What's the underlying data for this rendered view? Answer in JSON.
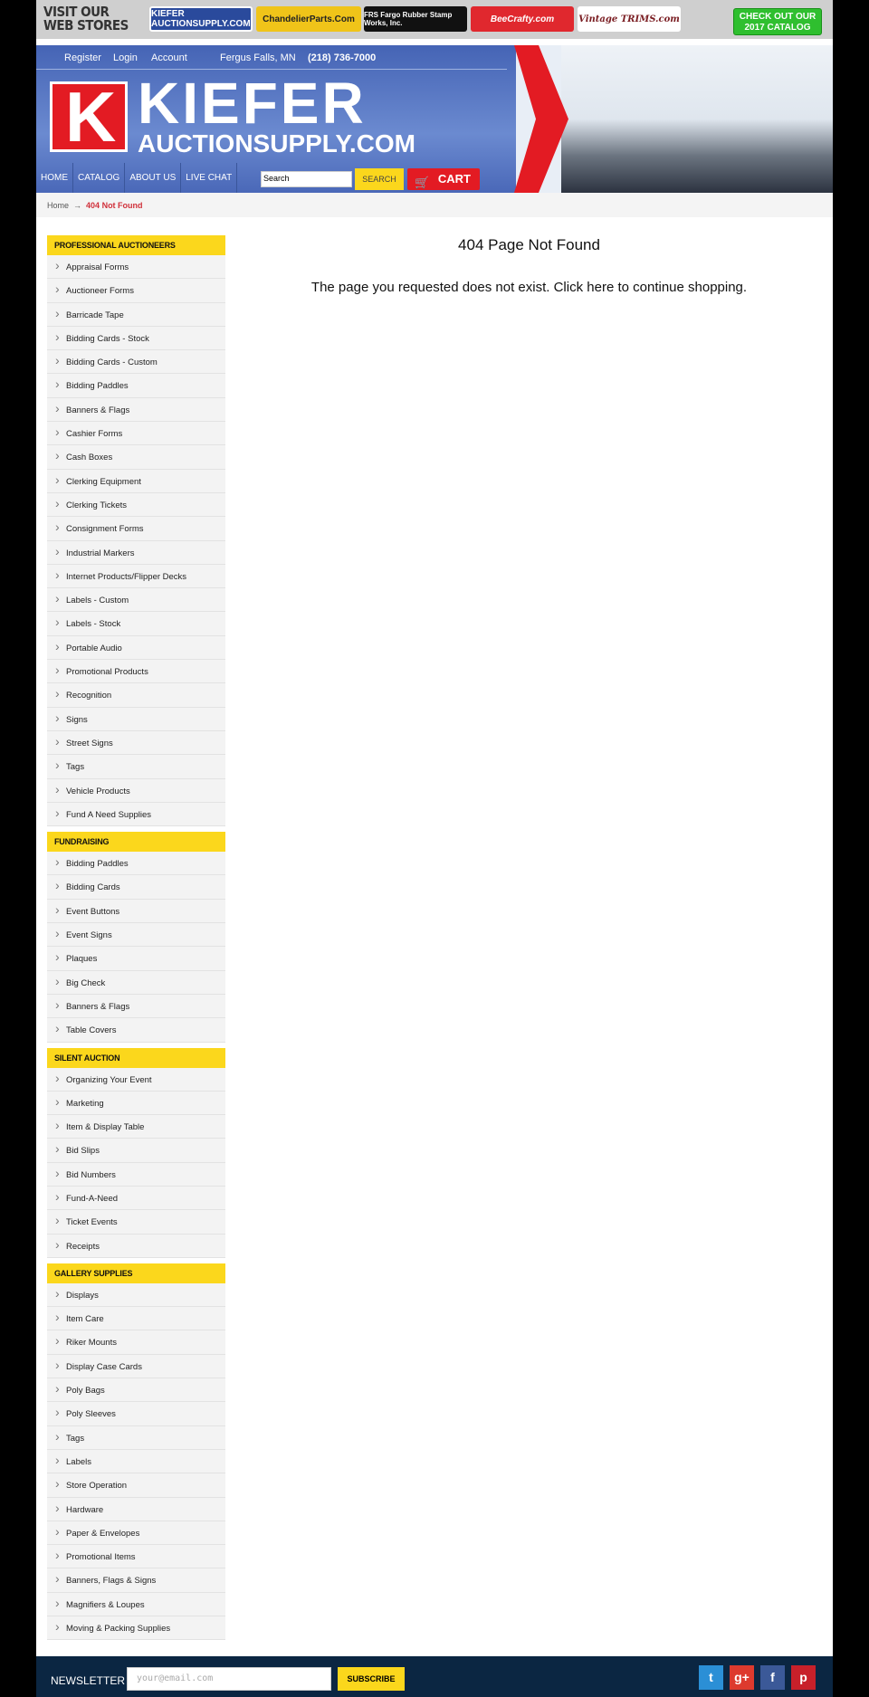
{
  "topbar": {
    "visit": "VISIT OUR WEB STORES",
    "stores": [
      "KIEFER AUCTIONSUPPLY.COM",
      "ChandelierParts.Com",
      "FRS Fargo Rubber Stamp Works, Inc.",
      "BeeCrafty.com",
      "Vintage TRIMS.com"
    ],
    "catalog": "CHECK OUT OUR 2017 CATALOG"
  },
  "header": {
    "links": [
      "Register",
      "Login",
      "Account"
    ],
    "location": "Fergus Falls, MN",
    "phone": "(218) 736-7000",
    "logo_line1": "KIEFER",
    "logo_line2": "AUCTIONSUPPLY.COM",
    "nav": [
      "HOME",
      "CATALOG",
      "ABOUT US",
      "LIVE CHAT"
    ],
    "search_placeholder": "Search",
    "search_button": "SEARCH",
    "cart": "CART"
  },
  "breadcrumb": {
    "home": "Home",
    "sep": "→",
    "current": "404 Not Found"
  },
  "main": {
    "title": "404 Page Not Found",
    "message": "The page you requested does not exist. Click here to continue shopping."
  },
  "sidebar": [
    {
      "heading": "PROFESSIONAL AUCTIONEERS",
      "items": [
        "Appraisal Forms",
        "Auctioneer Forms",
        "Barricade Tape",
        "Bidding Cards - Stock",
        "Bidding Cards - Custom",
        "Bidding Paddles",
        "Banners & Flags",
        "Cashier Forms",
        "Cash Boxes",
        "Clerking Equipment",
        "Clerking Tickets",
        "Consignment Forms",
        "Industrial Markers",
        "Internet Products/Flipper Decks",
        "Labels - Custom",
        "Labels - Stock",
        "Portable Audio",
        "Promotional Products",
        "Recognition",
        "Signs",
        "Street Signs",
        "Tags",
        "Vehicle Products",
        "Fund A Need Supplies"
      ]
    },
    {
      "heading": "FUNDRAISING",
      "items": [
        "Bidding Paddles",
        "Bidding Cards",
        "Event Buttons",
        "Event Signs",
        "Plaques",
        "Big Check",
        "Banners & Flags",
        "Table Covers"
      ]
    },
    {
      "heading": "SILENT AUCTION",
      "items": [
        "Organizing Your Event",
        "Marketing",
        "Item & Display Table",
        "Bid Slips",
        "Bid Numbers",
        "Fund-A-Need",
        "Ticket Events",
        "Receipts"
      ]
    },
    {
      "heading": "GALLERY SUPPLIES",
      "items": [
        "Displays",
        "Item Care",
        "Riker Mounts",
        "Display Case Cards",
        "Poly Bags",
        "Poly Sleeves",
        "Tags",
        "Labels",
        "Store Operation",
        "Hardware",
        "Paper & Envelopes",
        "Promotional Items",
        "Banners, Flags & Signs",
        "Magnifiers & Loupes",
        "Moving & Packing Supplies"
      ]
    }
  ],
  "footer": {
    "newsletter": "NEWSLETTER",
    "email_placeholder": "your@email.com",
    "subscribe": "SUBSCRIBE",
    "social": [
      {
        "name": "twitter-icon",
        "glyph": "t",
        "color": "#2b8fd6"
      },
      {
        "name": "google-plus-icon",
        "glyph": "g+",
        "color": "#dd3a2e"
      },
      {
        "name": "facebook-icon",
        "glyph": "f",
        "color": "#3b5998"
      },
      {
        "name": "pinterest-icon",
        "glyph": "p",
        "color": "#c8202a"
      }
    ]
  }
}
